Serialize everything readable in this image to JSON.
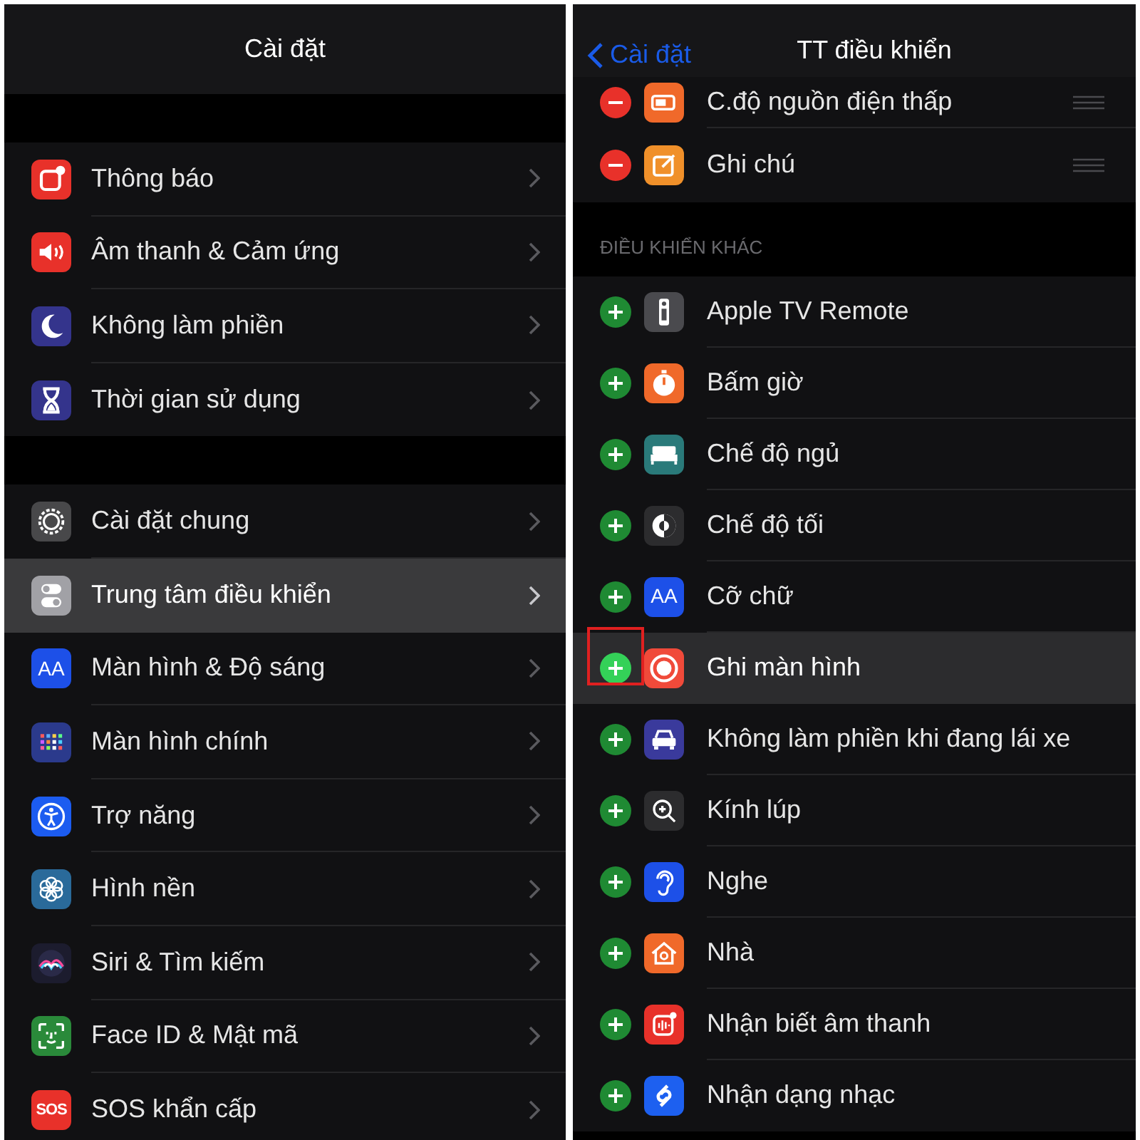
{
  "left_panel": {
    "title": "Cài đặt",
    "sections": [
      [
        {
          "label": "Thông báo",
          "selected": false
        },
        {
          "label": "Âm thanh & Cảm ứng",
          "selected": false
        },
        {
          "label": "Không làm phiền",
          "selected": false
        },
        {
          "label": "Thời gian sử dụng",
          "selected": false
        }
      ],
      [
        {
          "label": "Cài đặt chung",
          "selected": false
        },
        {
          "label": "Trung tâm điều khiển",
          "selected": true
        },
        {
          "label": "Màn hình & Độ sáng",
          "icon_text": "AA",
          "selected": false
        },
        {
          "label": "Màn hình chính",
          "selected": false
        },
        {
          "label": "Trợ năng",
          "selected": false
        },
        {
          "label": "Hình nền",
          "selected": false
        },
        {
          "label": "Siri & Tìm kiếm",
          "selected": false
        },
        {
          "label": "Face ID & Mật mã",
          "selected": false
        },
        {
          "label": "SOS khẩn cấp",
          "icon_text": "SOS",
          "selected": false
        }
      ]
    ]
  },
  "right_panel": {
    "back_button": "Cài đặt",
    "title": "TT điều khiển",
    "included": [
      {
        "label": "C.độ nguồn điện thấp"
      },
      {
        "label": "Ghi chú"
      }
    ],
    "section_header": "ĐIỀU KHIỂN KHÁC",
    "more": [
      {
        "label": "Apple TV Remote",
        "selected": false,
        "callout": false
      },
      {
        "label": "Bấm giờ",
        "selected": false,
        "callout": false
      },
      {
        "label": "Chế độ ngủ",
        "selected": false,
        "callout": false
      },
      {
        "label": "Chế độ tối",
        "selected": false,
        "callout": false
      },
      {
        "label": "Cỡ chữ",
        "icon_text": "AA",
        "selected": false,
        "callout": false
      },
      {
        "label": "Ghi màn hình",
        "selected": true,
        "callout": true
      },
      {
        "label": "Không làm phiền khi đang lái xe",
        "selected": false,
        "callout": false
      },
      {
        "label": "Kính lúp",
        "selected": false,
        "callout": false
      },
      {
        "label": "Nghe",
        "selected": false,
        "callout": false
      },
      {
        "label": "Nhà",
        "selected": false,
        "callout": false
      },
      {
        "label": "Nhận biết âm thanh",
        "selected": false,
        "callout": false
      },
      {
        "label": "Nhận dạng nhạc",
        "selected": false,
        "callout": false
      }
    ]
  }
}
